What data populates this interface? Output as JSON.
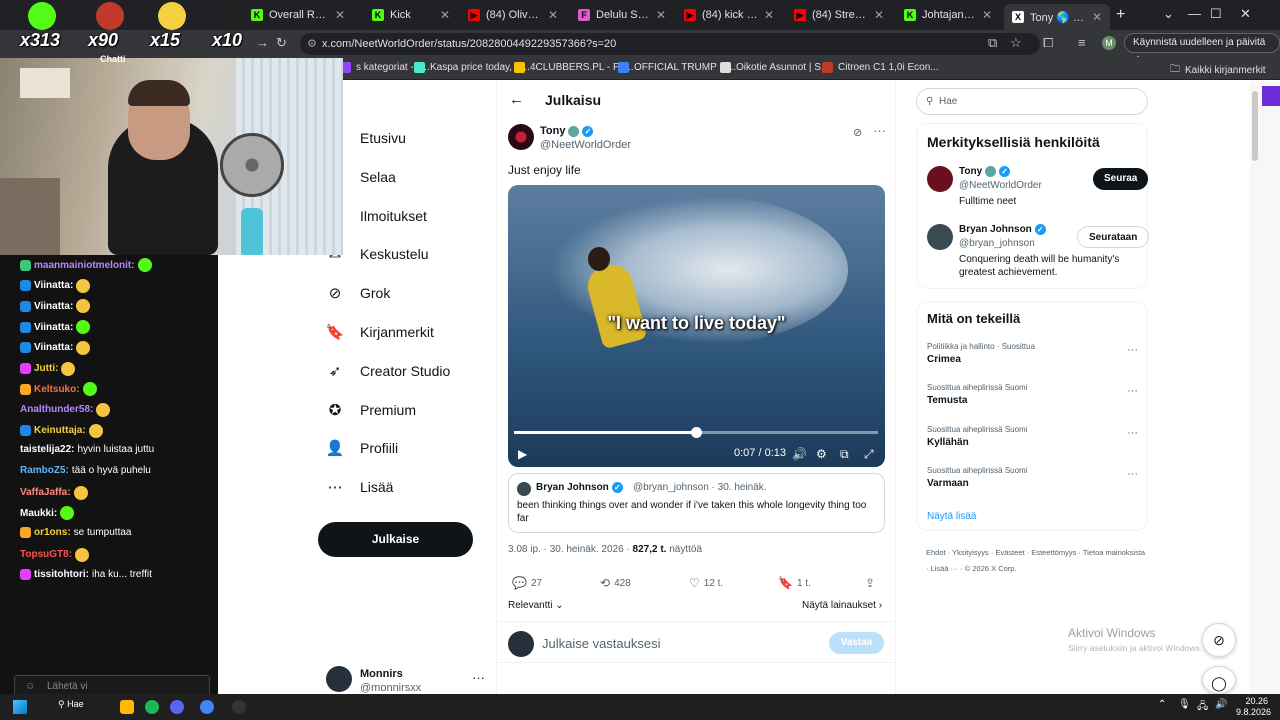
{
  "browser": {
    "tabs": [
      {
        "title": "Overall Revenue",
        "fav_color": "#53fc18",
        "fav_text": "K",
        "active": false
      },
      {
        "title": "Kick",
        "fav_color": "#53fc18",
        "fav_text": "K",
        "active": false
      },
      {
        "title": "(84) Oliver Tree &",
        "fav_color": "#ff0000",
        "fav_text": "▶",
        "active": false
      },
      {
        "title": "Delulu Stream",
        "fav_color": "#e05bd1",
        "fav_text": "F",
        "active": false
      },
      {
        "title": "(84) kick tubetus",
        "fav_color": "#ff0000",
        "fav_text": "▶",
        "active": false
      },
      {
        "title": "(84) StreamiClipit",
        "fav_color": "#ff0000",
        "fav_text": "▶",
        "active": false
      },
      {
        "title": "JohtajanMatkass",
        "fav_color": "#53fc18",
        "fav_text": "K",
        "active": false
      },
      {
        "title": "Tony 🌎 X:ssä: \"J",
        "fav_color": "#ffffff",
        "fav_text": "X",
        "active": true
      }
    ],
    "url": "x.com/NeetWorldOrder/status/2082800449229357366?s=20",
    "restart_label": "Käynnistä uudelleen ja päivitä",
    "profile_initial": "M",
    "bookmarks": [
      {
        "label": "s kategoriat - T...",
        "color": "#9146ff"
      },
      {
        "label": "Kaspa price today, K...",
        "color": "#49eacb"
      },
      {
        "label": "4CLUBBERS.PL - Po...",
        "color": "#f7c400"
      },
      {
        "label": "OFFICIAL TRUMP pr...",
        "color": "#3b82f6"
      },
      {
        "label": "Oikotie Asunnot | S...",
        "color": "#dddddd"
      },
      {
        "label": "Citroen C1 1,0i Econ...",
        "color": "#c0392b"
      }
    ],
    "bookmarks_all": "Kaikki kirjanmerkit"
  },
  "stream": {
    "counters": [
      {
        "value": "x313",
        "color": "#53fc18"
      },
      {
        "value": "x90",
        "color": "#c0392b"
      },
      {
        "value": "x15",
        "color": "#f5d142"
      },
      {
        "value": "x10",
        "color": "#222222"
      }
    ],
    "chat_label": "Chatti",
    "url_fragment": "om/po... nnirs/c",
    "chat": [
      {
        "nick": "maanmainiotmelonit:",
        "nick_color": "#b388ff",
        "text": "",
        "badge": "#3ec77a"
      },
      {
        "nick": "Viinatta:",
        "nick_color": "#ffffff",
        "text": "",
        "badge": "#1e88e5"
      },
      {
        "nick": "Viinatta:",
        "nick_color": "#ffffff",
        "text": "",
        "badge": "#1e88e5"
      },
      {
        "nick": "Viinatta:",
        "nick_color": "#ffffff",
        "text": "",
        "badge": "#1e88e5"
      },
      {
        "nick": "Viinatta:",
        "nick_color": "#ffffff",
        "text": "",
        "badge": "#1e88e5"
      },
      {
        "nick": "Jutti:",
        "nick_color": "#f5d142",
        "text": "",
        "badge": "#e040fb"
      },
      {
        "nick": "Keltsuko:",
        "nick_color": "#ff6e40",
        "text": "",
        "badge": "#f9a825"
      },
      {
        "nick": "Analthunder58:",
        "nick_color": "#b388ff",
        "text": "",
        "badge": ""
      },
      {
        "nick": "Keinuttaja:",
        "nick_color": "#f5d142",
        "text": "",
        "badge": "#1e88e5"
      },
      {
        "nick": "taistelija22:",
        "nick_color": "#ffffff",
        "text": "hyvin luistaa juttu",
        "badge": ""
      },
      {
        "nick": "RamboZ5:",
        "nick_color": "#64b5f6",
        "text": "tää o hyvä puhelu",
        "badge": ""
      },
      {
        "nick": "VaffaJaffa:",
        "nick_color": "#ff8a80",
        "text": "",
        "badge": ""
      },
      {
        "nick": "Maukki:",
        "nick_color": "#ffffff",
        "text": "",
        "badge": ""
      },
      {
        "nick": "or1ons:",
        "nick_color": "#f5d142",
        "text": "se tumputtaa",
        "badge": "#f9a825"
      },
      {
        "nick": "TopsuGT8:",
        "nick_color": "#ff5252",
        "text": "",
        "badge": ""
      },
      {
        "nick": "tissitohtori:",
        "nick_color": "#ffffff",
        "text": "iha ku...    treffit",
        "badge": "#e040fb"
      }
    ],
    "chat_input_placeholder": "Lähetä vi",
    "chat_bottom_icon": "∞"
  },
  "x": {
    "nav": [
      {
        "label": "Etusivu",
        "icon": "home-icon",
        "glyph": ""
      },
      {
        "label": "Selaa",
        "icon": "search-icon",
        "glyph": ""
      },
      {
        "label": "Ilmoitukset",
        "icon": "bell-icon",
        "glyph": ""
      },
      {
        "label": "Keskustelu",
        "icon": "mail-icon",
        "glyph": "✉"
      },
      {
        "label": "Grok",
        "icon": "grok-icon",
        "glyph": "⊘"
      },
      {
        "label": "Kirjanmerkit",
        "icon": "bookmark-icon",
        "glyph": "🔖"
      },
      {
        "label": "Creator Studio",
        "icon": "rocket-icon",
        "glyph": "➶"
      },
      {
        "label": "Premium",
        "icon": "premium-icon",
        "glyph": "✪"
      },
      {
        "label": "Profiili",
        "icon": "profile-icon",
        "glyph": "👤"
      },
      {
        "label": "Lisää",
        "icon": "more-icon",
        "glyph": "⋯"
      }
    ],
    "post_button": "Julkaise",
    "account": {
      "name": "Monnirs",
      "handle": "@monnirsxx"
    },
    "header_title": "Julkaisu",
    "post": {
      "name": "Tony",
      "handle": "@NeetWorldOrder",
      "text": "Just enjoy life",
      "video_caption": "\"I want to live today\"",
      "video_time": "0:07 / 0:13",
      "progress": 0.5,
      "quote": {
        "name": "Bryan Johnson",
        "meta": "@bryan_johnson · 30. heinäk.",
        "text": "been thinking things over and wonder if i've taken this whole longevity thing too far"
      },
      "timestamp": "3.08 ip. · 30. heinäk. 2026 ·",
      "views_count": "827,2 t.",
      "views_label": "näyttöä",
      "replies": "27",
      "reposts": "428",
      "likes": "12 t.",
      "bookmarks": "1 t.",
      "sort_label": "Relevantti",
      "show_quotes": "Näytä lainaukset"
    },
    "reply": {
      "placeholder": "Julkaise vastauksesi",
      "button": "Vastaa"
    },
    "search_placeholder": "Hae",
    "relevant_title": "Merkityksellisiä henkilöitä",
    "relevant_people": [
      {
        "name": "Tony",
        "handle": "@NeetWorldOrder",
        "bio": "Fulltime neet",
        "button": "Seuraa",
        "avatar_color": "#6b0f1f"
      },
      {
        "name": "Bryan Johnson",
        "handle": "@bryan_johnson",
        "bio": "Conquering death will be humanity's greatest achievement.",
        "button": "Seurataan",
        "avatar_color": "#3a4a52"
      }
    ],
    "trends_title": "Mitä on tekeillä",
    "trends": [
      {
        "meta": "Politiikka ja hallinto · Suosittua",
        "name": "Crimea"
      },
      {
        "meta": "Suosittua aiheplirissä Suomi",
        "name": "Temusta"
      },
      {
        "meta": "Suosittua aiheplirissä Suomi",
        "name": "Kyllähän"
      },
      {
        "meta": "Suosittua aiheplirissä Suomi",
        "name": "Varmaan"
      }
    ],
    "show_more": "Näytä lisää",
    "footer": "Ehdot  ·  Yksityisyys  ·  Evästeet  ·  Esteettömyys  ·  Tietoa mainoksista  ·  Lisää ···  ·  © 2026 X Corp."
  },
  "windows": {
    "activate_title": "Aktivoi Windows",
    "activate_sub": "Siirry asetuksiin ja aktivoi Windows.",
    "taskbar_search": "Hae",
    "time": "20.26",
    "date": "9.8.2026"
  }
}
